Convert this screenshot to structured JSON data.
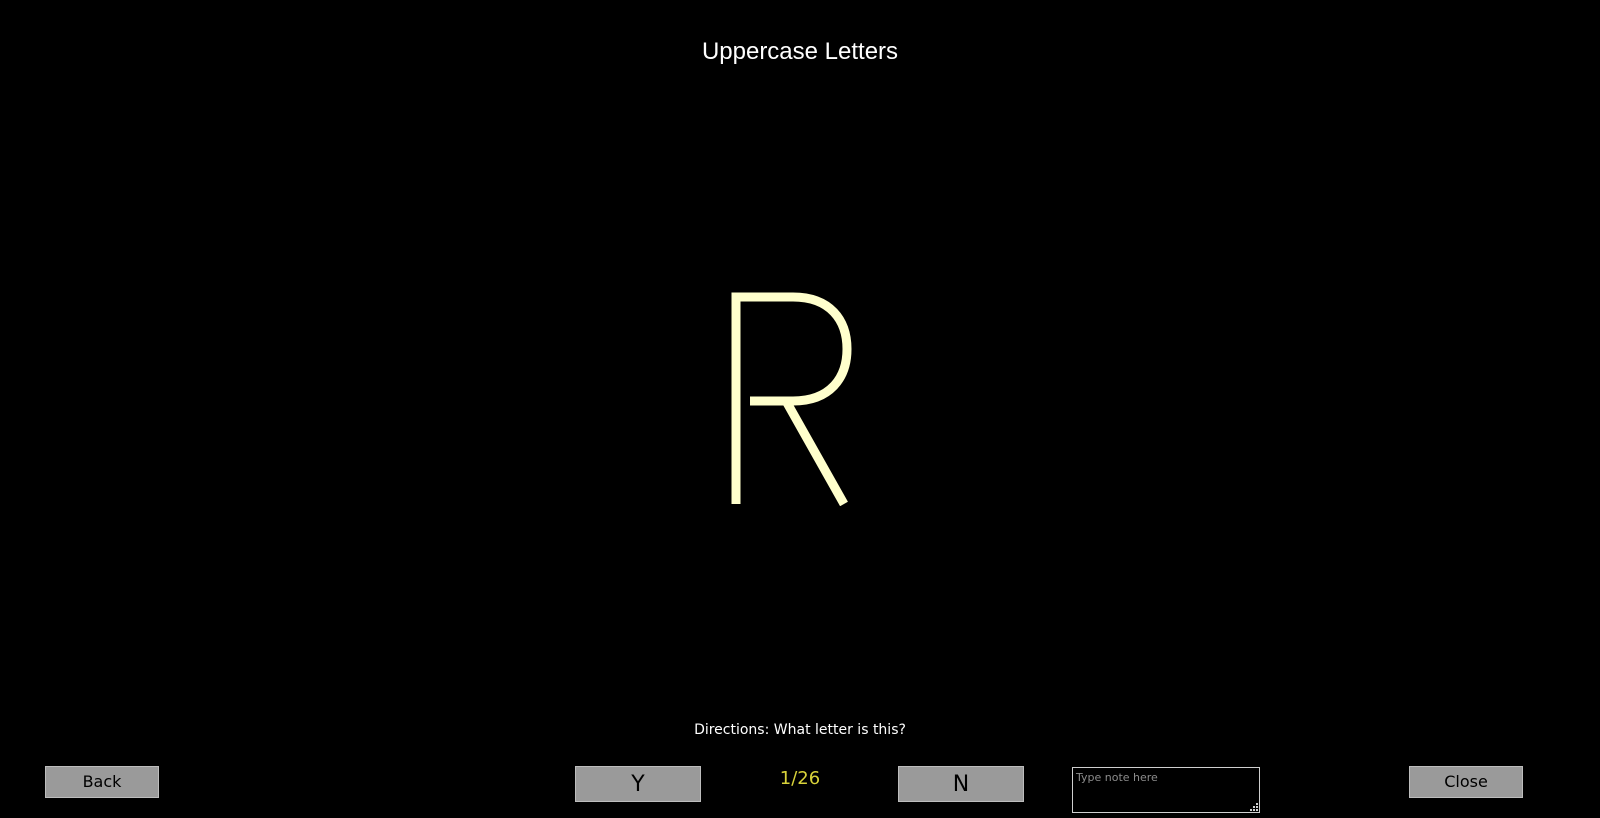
{
  "header": {
    "title": "Uppercase Letters"
  },
  "card": {
    "letter": "R",
    "letter_color": "#ffffcc"
  },
  "instructions": {
    "directions": "Directions: What letter is this?"
  },
  "controls": {
    "back_label": "Back",
    "yes_label": "Y",
    "counter": "1/26",
    "no_label": "N",
    "note_placeholder": "Type note here",
    "note_value": "",
    "close_label": "Close"
  },
  "colors": {
    "background": "#000000",
    "button_bg": "#9a9a9a",
    "counter_text": "#d8d23a"
  },
  "icons": {
    "grip": "resize-grip-icon"
  }
}
